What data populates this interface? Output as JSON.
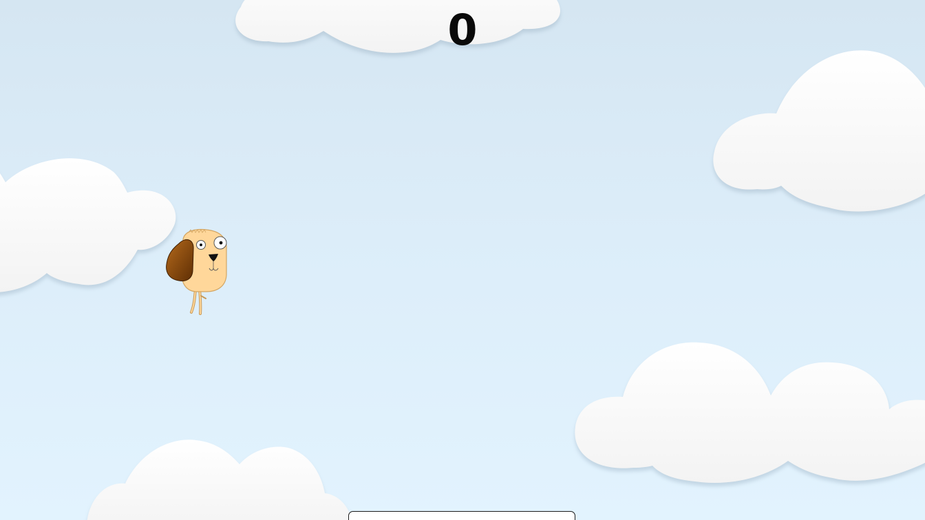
{
  "game": {
    "score": "0"
  },
  "colors": {
    "sky_top": "#d5e6f2",
    "sky_bottom": "#e2f3fe",
    "cloud": "#ffffff",
    "score_text": "#0a0a0a",
    "dog_face": "#ffd79a",
    "dog_ear": "#8a4a0e"
  },
  "icons": {
    "player": "dog-icon"
  }
}
